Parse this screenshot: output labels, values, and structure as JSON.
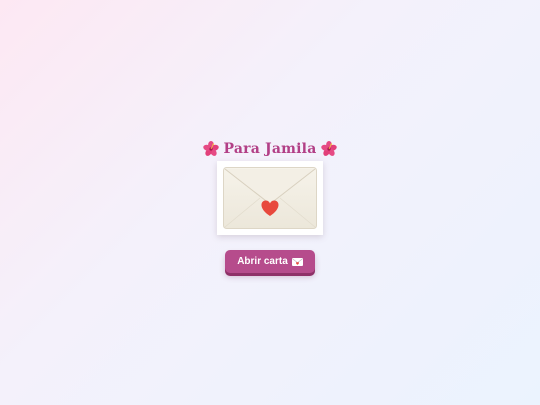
{
  "letter": {
    "title": "Para Jamila",
    "title_icon": "hibiscus-icon",
    "envelope_icon": "envelope-heart-icon",
    "open_button_label": "Abrir carta",
    "open_button_icon": "love-letter-icon"
  },
  "colors": {
    "title": "#b23f86",
    "button": "#b64c8c",
    "heart": "#e8493d",
    "background_start": "#fde8f3",
    "background_end": "#ebf3fe"
  }
}
